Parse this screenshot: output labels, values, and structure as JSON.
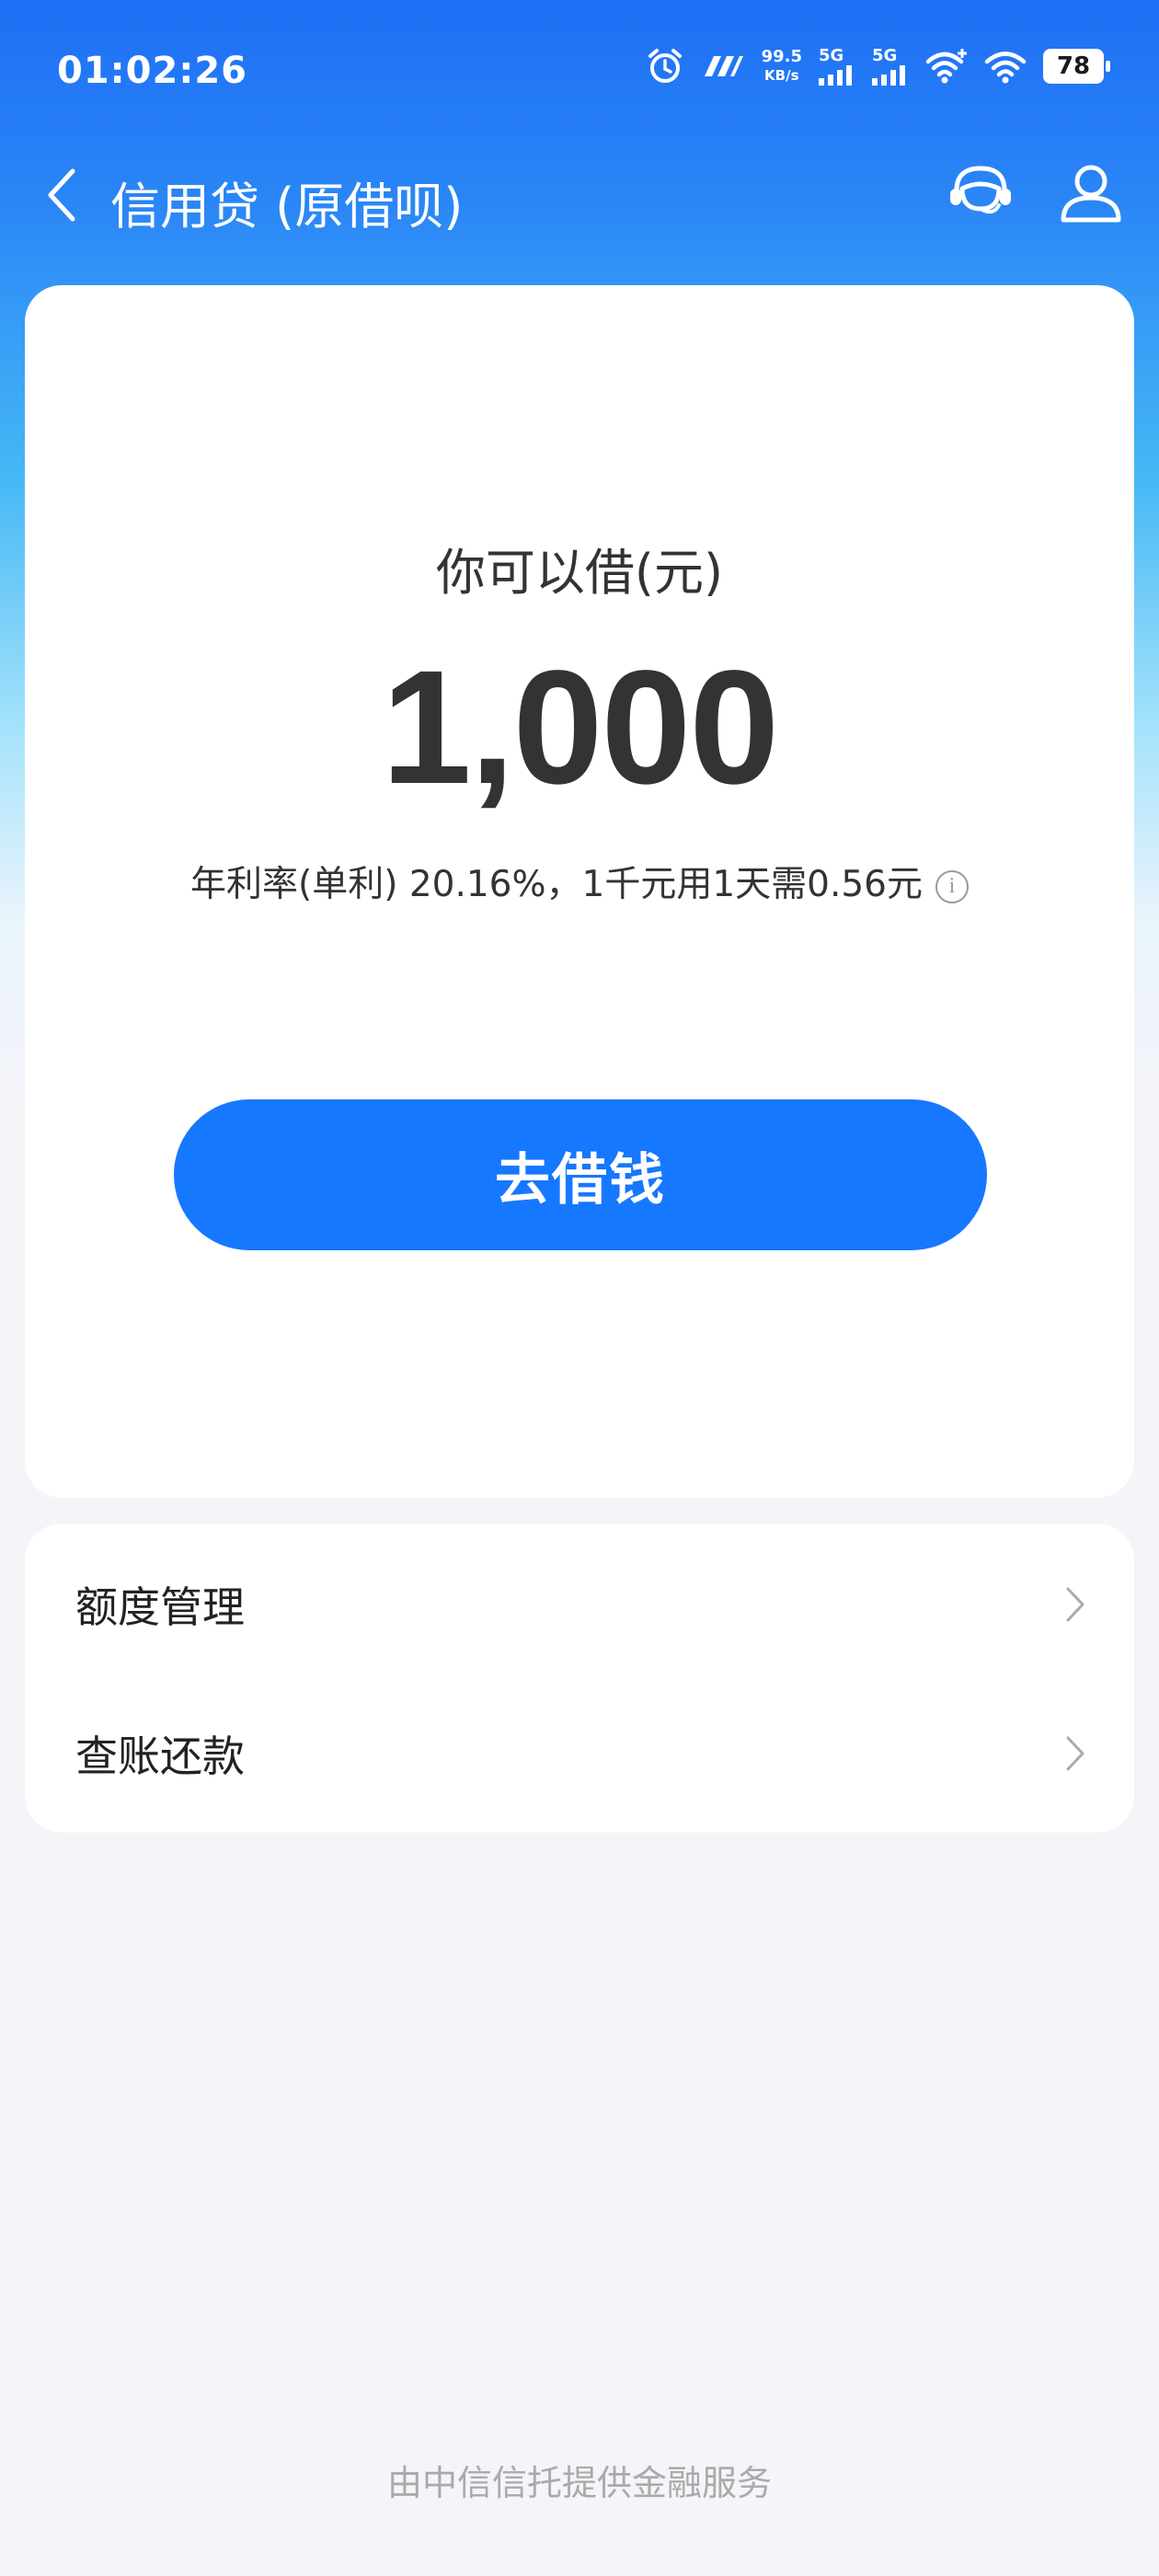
{
  "status_bar": {
    "time": "01:02:26",
    "net_speed_value": "99.5",
    "net_speed_unit": "KB/s",
    "signal1_label": "5G",
    "signal2_label": "5G",
    "battery": "78"
  },
  "header": {
    "title": "信用贷 (原借呗)",
    "icons": [
      "back-arrow-icon",
      "customer-service-icon",
      "user-icon"
    ]
  },
  "loan_card": {
    "available_label": "你可以借(元)",
    "available_amount": "1,000",
    "rate_text": "年利率(单利) 20.16%，1千元用1天需0.56元",
    "info_icon": "i",
    "borrow_button": "去借钱"
  },
  "menu": {
    "items": [
      {
        "label": "额度管理"
      },
      {
        "label": "查账还款"
      }
    ]
  },
  "footer": {
    "text": "由中信信托提供金融服务"
  },
  "colors": {
    "primary": "#1677ff",
    "header_gradient_top": "#1e6ff5",
    "page_background": "#f4f4f9"
  }
}
